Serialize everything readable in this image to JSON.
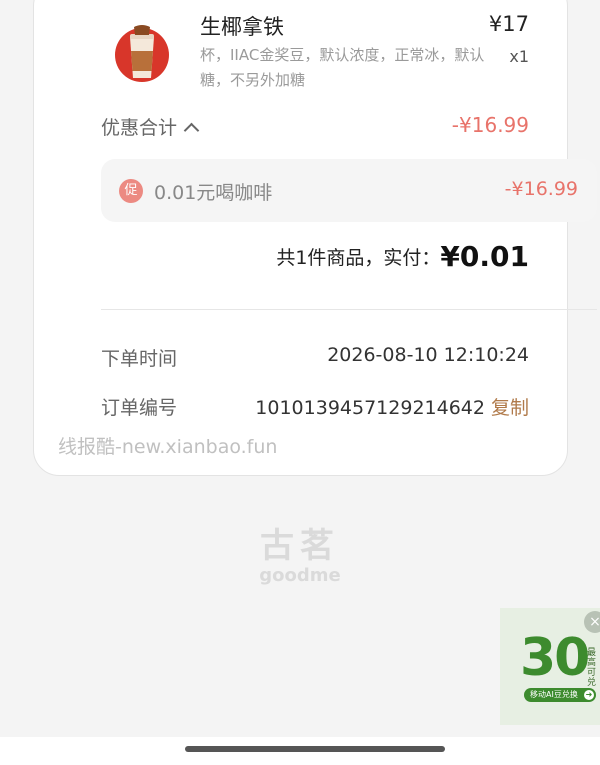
{
  "product": {
    "name": "生椰拿铁",
    "price": "¥17",
    "description": "杯，IIAC金奖豆，默认浓度，正常冰，默认糖，不另外加糖",
    "quantity": "x1"
  },
  "discount": {
    "label": "优惠合计",
    "total": "-¥16.99",
    "items": [
      {
        "icon_text": "促",
        "label": "0.01元喝咖啡",
        "amount": "-¥16.99"
      }
    ]
  },
  "summary": {
    "text": "共1件商品，实付：",
    "total": "¥0.01"
  },
  "order": {
    "time_label": "下单时间",
    "time_value": "2026-08-10 12:10:24",
    "number_label": "订单编号",
    "number_value": "1010139457129214642",
    "copy_label": "复制"
  },
  "watermark": "线报酷-new.xianbao.fun",
  "brand": {
    "name_cn": "古茗",
    "name_en": "goodme"
  },
  "ad": {
    "number": "30",
    "side_text": "最高可兑",
    "button_label": "移动AI豆兑换",
    "close": "×",
    "arrow": "➜"
  },
  "colors": {
    "discount_red": "#e8736a",
    "copy_brown": "#b07a4a",
    "ad_green": "#3d8b2e"
  },
  "icons": [
    "product-thumbnail",
    "chevron-up-icon",
    "promo-badge-icon",
    "close-icon",
    "arrow-right-icon"
  ]
}
